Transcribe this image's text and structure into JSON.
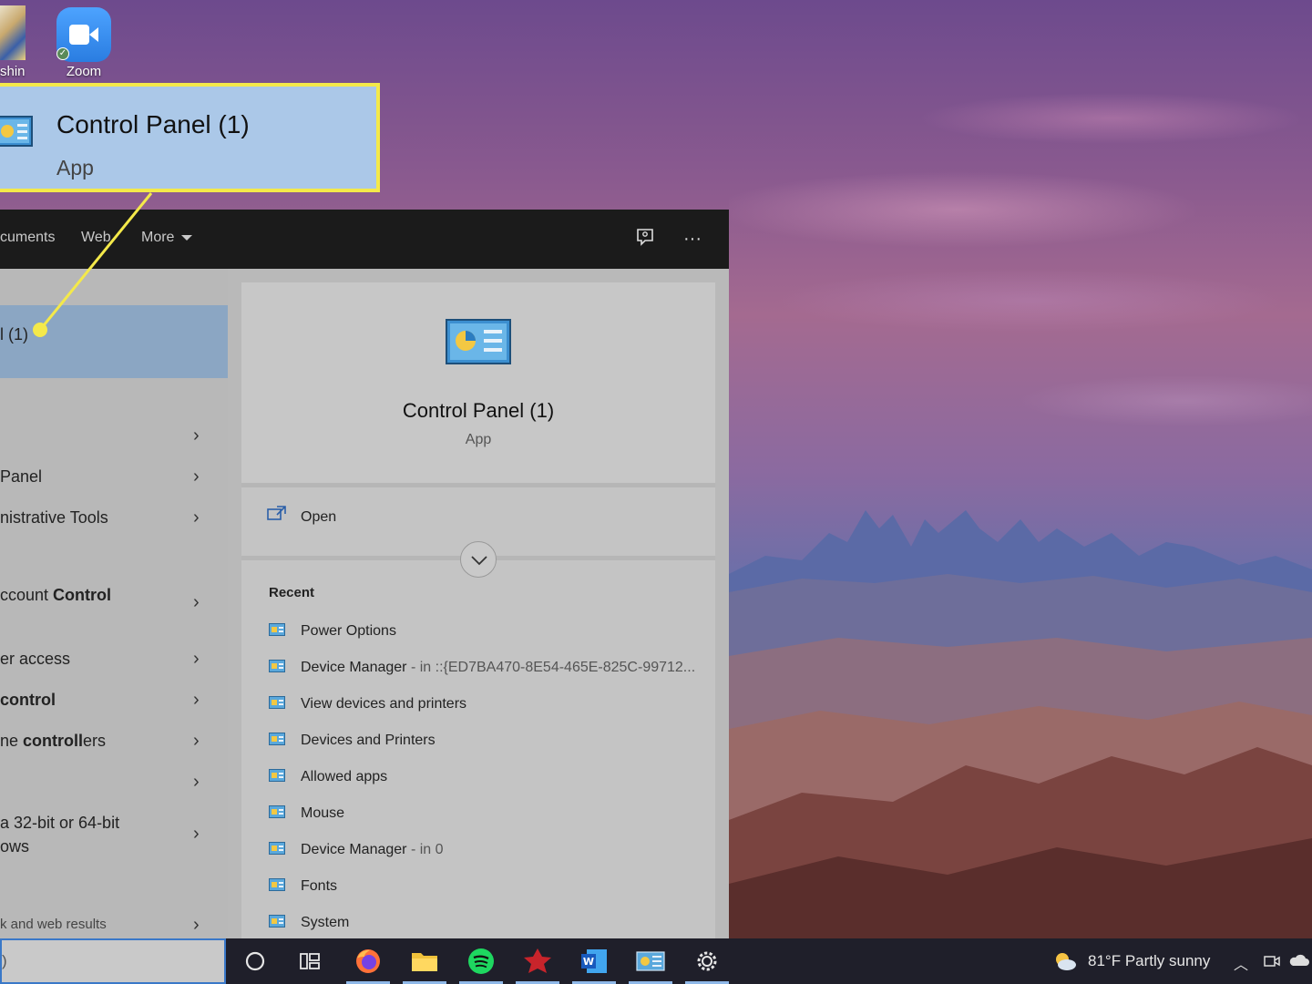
{
  "desktop": {
    "icons": [
      {
        "label": "shin"
      },
      {
        "label": "Zoom"
      }
    ]
  },
  "callout": {
    "title": "Control Panel (1)",
    "subtitle": "App",
    "border_color": "#f4e94a",
    "fill_color": "#abc8e8"
  },
  "search_panel": {
    "tabs": [
      {
        "label": "cuments"
      },
      {
        "label": "Web"
      },
      {
        "label": "More"
      }
    ],
    "toolbar_icons": [
      "feedback-icon",
      "more-options-icon"
    ],
    "best_match": {
      "label": "l (1)"
    },
    "left_rows": [
      {
        "label": ""
      },
      {
        "label": " Panel"
      },
      {
        "label": "nistrative Tools"
      },
      {
        "label_plain": "ccount ",
        "label_bold": "Control"
      },
      {
        "label": "er access"
      },
      {
        "label_bold": "control"
      },
      {
        "label_plain": "ne ",
        "label_bold": "controll",
        "label_tail": "ers"
      },
      {
        "label": ""
      },
      {
        "label_line1": "a 32-bit or 64-bit",
        "label_line2": "ows"
      },
      {
        "label": "k and web results"
      }
    ],
    "detail": {
      "title": "Control Panel (1)",
      "subtitle": "App",
      "open_label": "Open",
      "recent_title": "Recent",
      "recent": [
        {
          "label": "Power Options",
          "location": ""
        },
        {
          "label": "Device Manager",
          "location": " - in ::{ED7BA470-8E54-465E-825C-99712..."
        },
        {
          "label": "View devices and printers",
          "location": ""
        },
        {
          "label": "Devices and Printers",
          "location": ""
        },
        {
          "label": "Allowed apps",
          "location": ""
        },
        {
          "label": "Mouse",
          "location": ""
        },
        {
          "label": "Device Manager",
          "location": " - in 0"
        },
        {
          "label": "Fonts",
          "location": ""
        },
        {
          "label": "System",
          "location": ""
        }
      ]
    }
  },
  "taskbar": {
    "search_placeholder": ")",
    "apps": [
      "cortana-icon",
      "task-view-icon",
      "firefox-icon",
      "file-explorer-icon",
      "spotify-icon",
      "game-icon",
      "word-icon",
      "control-panel-icon",
      "settings-icon"
    ],
    "weather": "81°F  Partly sunny",
    "accent": "#3a78c8"
  }
}
